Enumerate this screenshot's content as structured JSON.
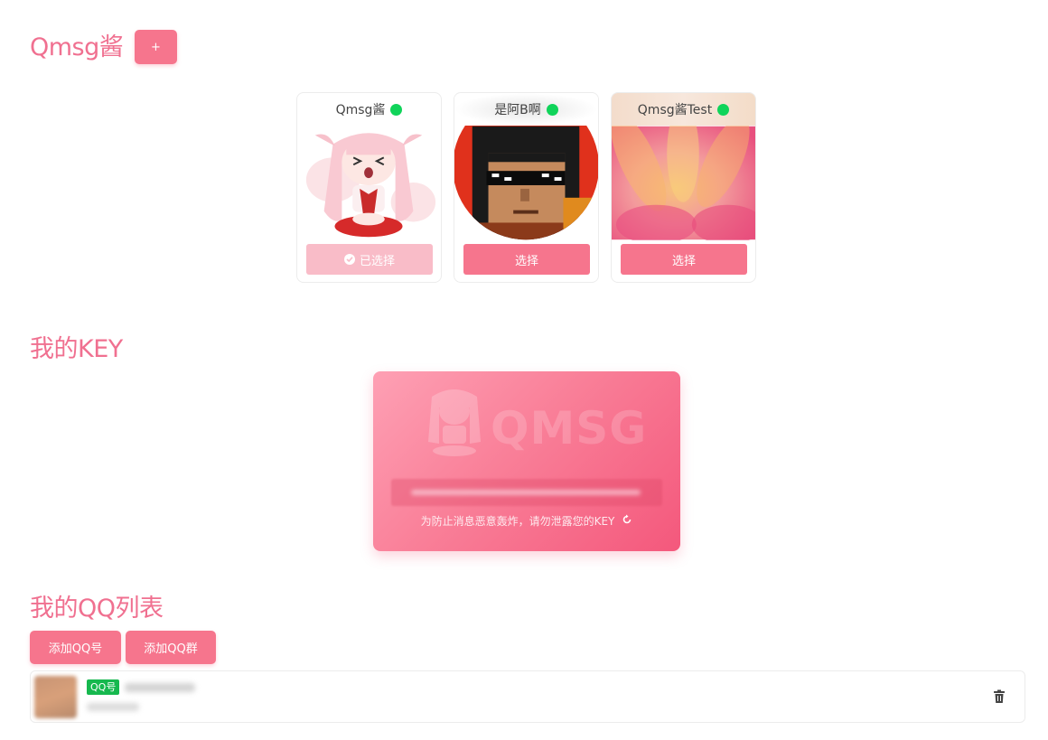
{
  "header": {
    "title": "Qmsg酱",
    "add_label": "+"
  },
  "bots": [
    {
      "name": "Qmsg酱",
      "status": "online",
      "button": "已选择",
      "selected": true
    },
    {
      "name": "是阿B啊",
      "status": "online",
      "button": "选择",
      "selected": false
    },
    {
      "name": "Qmsg酱Test",
      "status": "online",
      "button": "选择",
      "selected": false
    }
  ],
  "key_section": {
    "title": "我的KEY",
    "brand": "QMSG",
    "key_value": "",
    "hint": "为防止消息恶意轰炸，请勿泄露您的KEY",
    "refresh_icon": "refresh-icon"
  },
  "qq_section": {
    "title": "我的QQ列表",
    "add_qq_label": "添加QQ号",
    "add_group_label": "添加QQ群",
    "items": [
      {
        "tag": "QQ号",
        "number": "",
        "sub": ""
      }
    ]
  },
  "colors": {
    "accent": "#f6758d",
    "title": "#f07090",
    "online": "#10d45a",
    "tag": "#16b84e"
  }
}
